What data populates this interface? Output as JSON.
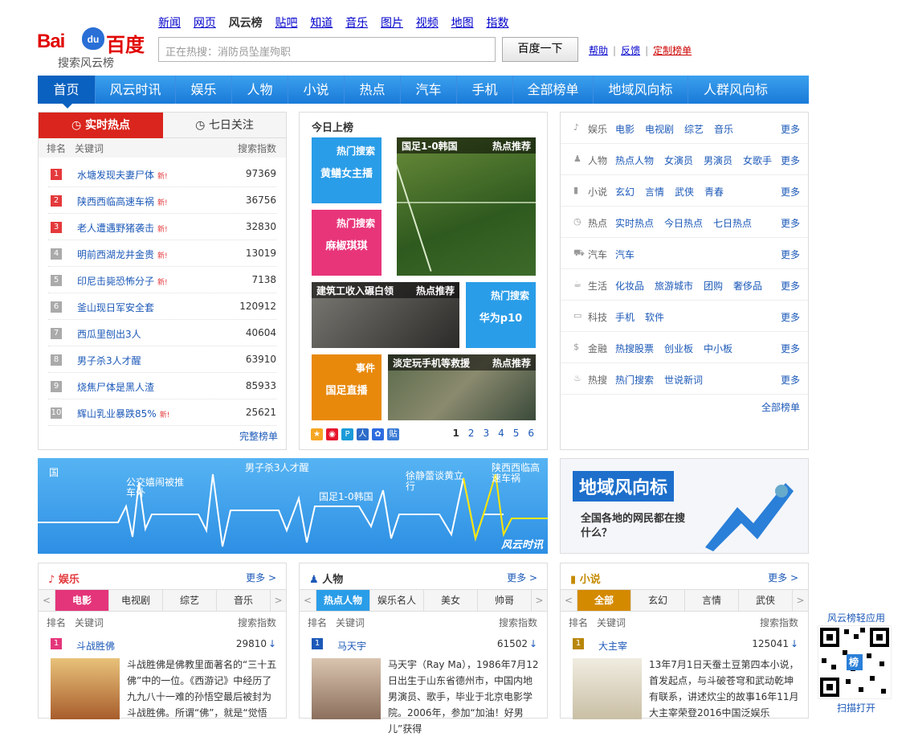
{
  "logo": {
    "bai": "Bai",
    "du": "du",
    "baidu_cn": "百度",
    "sub": "搜索风云榜"
  },
  "topnav": [
    "新闻",
    "网页",
    "风云榜",
    "贴吧",
    "知道",
    "音乐",
    "图片",
    "视频",
    "地图",
    "指数"
  ],
  "search": {
    "placeholder": "正在热搜：消防员坠崖殉职",
    "button": "百度一下"
  },
  "header_links": {
    "help": "帮助",
    "feedback": "反馈",
    "custom": "定制榜单"
  },
  "mainnav": [
    "首页",
    "风云时讯",
    "娱乐",
    "人物",
    "小说",
    "热点",
    "汽车",
    "手机",
    "全部榜单",
    "地域风向标",
    "人群风向标"
  ],
  "hot": {
    "tab_realtime": "实时热点",
    "tab_week": "七日关注",
    "head": {
      "rank": "排名",
      "keyword": "关键词",
      "index": "搜索指数"
    },
    "new_tag": "新!",
    "items": [
      {
        "rank": "1",
        "kw": "水塘发现夫妻尸体",
        "new": true,
        "num": "97369"
      },
      {
        "rank": "2",
        "kw": "陕西西临高速车祸",
        "new": true,
        "num": "36756"
      },
      {
        "rank": "3",
        "kw": "老人遭遇野猪袭击",
        "new": true,
        "num": "32830"
      },
      {
        "rank": "4",
        "kw": "明前西湖龙井金贵",
        "new": true,
        "num": "13019"
      },
      {
        "rank": "5",
        "kw": "印尼击毙恐怖分子",
        "new": true,
        "num": "7138"
      },
      {
        "rank": "6",
        "kw": "釜山现日军安全套",
        "new": false,
        "num": "120912"
      },
      {
        "rank": "7",
        "kw": "西瓜里刨出3人",
        "new": false,
        "num": "40604"
      },
      {
        "rank": "8",
        "kw": "男子杀3人才醒",
        "new": false,
        "num": "63910"
      },
      {
        "rank": "9",
        "kw": "烧焦尸体是黑人渣",
        "new": false,
        "num": "85933"
      },
      {
        "rank": "10",
        "kw": "辉山乳业暴跌85%",
        "new": true,
        "num": "25621"
      }
    ],
    "more": "完整榜单"
  },
  "today": {
    "title": "今日上榜",
    "tiles": [
      {
        "tag": "热门搜索",
        "main": "黄鳝女主播"
      },
      {
        "tag": "热门搜索",
        "main": "麻椒琪琪"
      },
      {
        "tag": "热门搜索",
        "main": "华为p10"
      },
      {
        "tag": "事件",
        "main": "国足直播"
      }
    ],
    "photos": [
      {
        "cap": "国足1-0韩国",
        "tag": "热点推荐"
      },
      {
        "cap": "建筑工收入碾白领",
        "tag": "热点推荐"
      },
      {
        "cap": "淡定玩手机等救援",
        "tag": "热点推荐"
      }
    ],
    "pages": [
      "1",
      "2",
      "3",
      "4",
      "5",
      "6"
    ]
  },
  "cats": [
    {
      "icon": "♪",
      "name": "娱乐",
      "links": [
        "电影",
        "电视剧",
        "综艺",
        "音乐"
      ],
      "more": "更多"
    },
    {
      "icon": "♟",
      "name": "人物",
      "links": [
        "热点人物",
        "女演员",
        "男演员",
        "女歌手"
      ],
      "more": "更多"
    },
    {
      "icon": "▮",
      "name": "小说",
      "links": [
        "玄幻",
        "言情",
        "武侠",
        "青春"
      ],
      "more": "更多"
    },
    {
      "icon": "◷",
      "name": "热点",
      "links": [
        "实时热点",
        "今日热点",
        "七日热点"
      ],
      "more": "更多"
    },
    {
      "icon": "⛟",
      "name": "汽车",
      "links": [
        "汽车"
      ],
      "more": "更多"
    },
    {
      "icon": "☕",
      "name": "生活",
      "links": [
        "化妆品",
        "旅游城市",
        "团购",
        "奢侈品"
      ],
      "more": "更多"
    },
    {
      "icon": "▭",
      "name": "科技",
      "links": [
        "手机",
        "软件"
      ],
      "more": "更多"
    },
    {
      "icon": "$",
      "name": "金融",
      "links": [
        "热搜股票",
        "创业板",
        "中小板"
      ],
      "more": "更多"
    },
    {
      "icon": "♨",
      "name": "热搜",
      "links": [
        "热门搜索",
        "世说新词"
      ],
      "more": "更多"
    }
  ],
  "cats_all": "全部榜单",
  "ecg": {
    "labels": [
      "男子杀3人才醒",
      "公交嬉闹被推车外",
      "徐静蕾谈黄立行",
      "陕西西临高速车祸",
      "国足1-0韩国",
      "国"
    ],
    "badge": "风云时讯"
  },
  "regional": {
    "title": "地域风向标",
    "desc": "全国各地的网民都在搜什么？"
  },
  "ent": {
    "title": "娱乐",
    "more": "更多 >",
    "tabs": [
      "电影",
      "电视剧",
      "综艺",
      "音乐"
    ],
    "first": {
      "rank": "1",
      "kw": "斗战胜佛",
      "num": "29810"
    },
    "desc": "斗战胜佛是佛教里面著名的“三十五佛”中的一位。《西游记》中经历了九九八十一难的孙悟空最后被封为斗战胜佛。所谓“佛”，就是“觉悟"
  },
  "people": {
    "title": "人物",
    "more": "更多 >",
    "tabs": [
      "热点人物",
      "娱乐名人",
      "美女",
      "帅哥"
    ],
    "first": {
      "rank": "1",
      "kw": "马天宇",
      "num": "61502"
    },
    "desc": "马天宇（Ray Ma），1986年7月12日出生于山东省德州市，中国内地男演员、歌手，毕业于北京电影学院。2006年，参加“加油！好男儿”获得"
  },
  "novel": {
    "title": "小说",
    "more": "更多 >",
    "tabs": [
      "全部",
      "玄幻",
      "言情",
      "武侠"
    ],
    "first": {
      "rank": "1",
      "kw": "大主宰",
      "num": "125041"
    },
    "desc": "13年7月1日天蚕土豆第四本小说，首发起点，与斗破苍穹和武动乾坤有联系，讲述炊尘的故事16年11月大主宰荣登2016中国泛娱乐"
  },
  "list_head": {
    "rank": "排名",
    "keyword": "关键词",
    "index": "搜索指数"
  },
  "qr": {
    "title": "风云榜轻应用",
    "scan": "扫描打开",
    "center": "榜"
  }
}
